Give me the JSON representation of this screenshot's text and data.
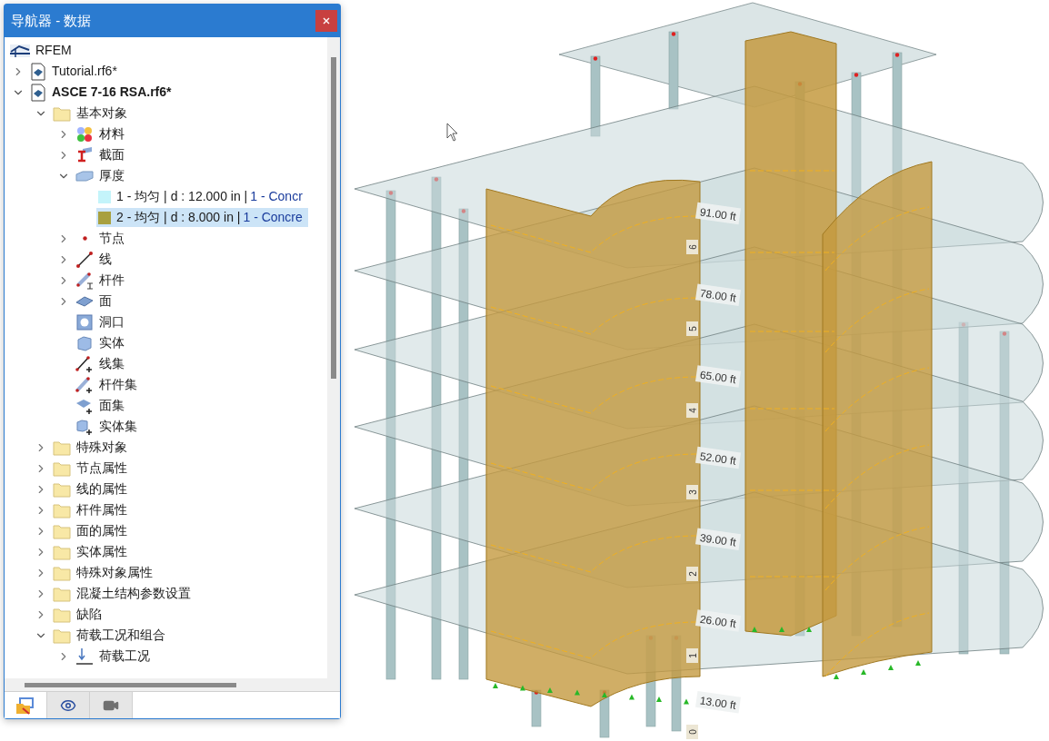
{
  "window": {
    "title": "导航器 - 数据"
  },
  "tree": [
    {
      "kind": "root",
      "label": "RFEM"
    },
    {
      "kind": "file",
      "label": "Tutorial.rf6*",
      "expanded": false
    },
    {
      "kind": "file",
      "label": "ASCE 7-16 RSA.rf6*",
      "bold": true,
      "expanded": true,
      "children": [
        {
          "kind": "folder",
          "label": "基本对象",
          "expanded": true,
          "children": [
            {
              "kind": "materials",
              "label": "材料",
              "expanded": false
            },
            {
              "kind": "section",
              "label": "截面",
              "expanded": false
            },
            {
              "kind": "thickness",
              "label": "厚度",
              "expanded": true,
              "children": [
                {
                  "kind": "swatch",
                  "label": "1 - 均匀 | d : 12.000 in |",
                  "material": "1 - Concr",
                  "color": "#c4f4fa",
                  "selected": false
                },
                {
                  "kind": "swatch",
                  "label": "2 - 均匀 | d : 8.000 in |",
                  "material": "1 - Concre",
                  "color": "#a8a040",
                  "selected": true
                }
              ]
            },
            {
              "kind": "node",
              "label": "节点",
              "expanded": false
            },
            {
              "kind": "line",
              "label": "线",
              "expanded": false
            },
            {
              "kind": "member",
              "label": "杆件",
              "expanded": false
            },
            {
              "kind": "surface",
              "label": "面",
              "expanded": false
            },
            {
              "kind": "opening",
              "label": "洞口"
            },
            {
              "kind": "solid",
              "label": "实体"
            },
            {
              "kind": "lineset",
              "label": "线集"
            },
            {
              "kind": "memberset",
              "label": "杆件集"
            },
            {
              "kind": "surfaceset",
              "label": "面集"
            },
            {
              "kind": "solidset",
              "label": "实体集"
            }
          ]
        },
        {
          "kind": "folder",
          "label": "特殊对象",
          "expanded": false
        },
        {
          "kind": "folder",
          "label": "节点属性",
          "expanded": false
        },
        {
          "kind": "folder",
          "label": "线的属性",
          "expanded": false
        },
        {
          "kind": "folder",
          "label": "杆件属性",
          "expanded": false
        },
        {
          "kind": "folder",
          "label": "面的属性",
          "expanded": false
        },
        {
          "kind": "folder",
          "label": "实体属性",
          "expanded": false
        },
        {
          "kind": "folder",
          "label": "特殊对象属性",
          "expanded": false
        },
        {
          "kind": "folder",
          "label": "混凝土结构参数设置",
          "expanded": false
        },
        {
          "kind": "folder",
          "label": "缺陷",
          "expanded": false
        },
        {
          "kind": "folder",
          "label": "荷载工况和组合",
          "expanded": true,
          "children": [
            {
              "kind": "loadcase",
              "label": "荷载工况",
              "expanded": false
            }
          ]
        }
      ]
    }
  ],
  "bottom_tabs": [
    {
      "kind": "data",
      "selected": true
    },
    {
      "kind": "view",
      "selected": false
    },
    {
      "kind": "camera",
      "selected": false
    }
  ],
  "model": {
    "elevations": [
      "91.00 ft",
      "78.00 ft",
      "65.00 ft",
      "52.00 ft",
      "39.00 ft",
      "26.00 ft",
      "13.00 ft"
    ],
    "stories": [
      "6",
      "5",
      "4",
      "3",
      "2",
      "1",
      "0"
    ]
  }
}
